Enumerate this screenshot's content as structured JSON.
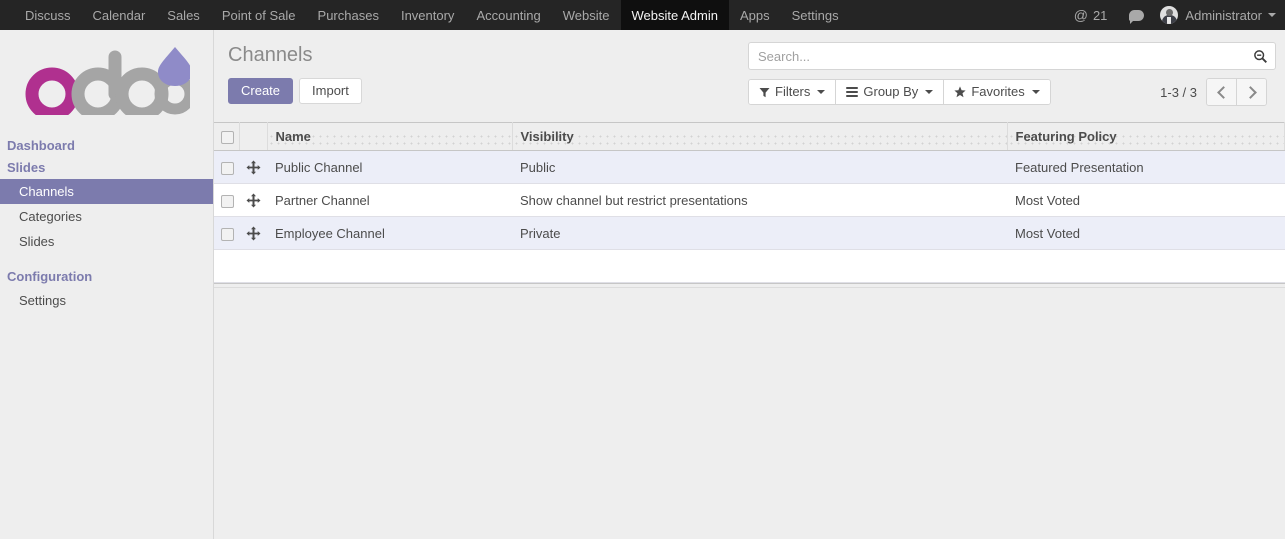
{
  "navbar": {
    "menu_items": [
      {
        "label": "Discuss",
        "active": false
      },
      {
        "label": "Calendar",
        "active": false
      },
      {
        "label": "Sales",
        "active": false
      },
      {
        "label": "Point of Sale",
        "active": false
      },
      {
        "label": "Purchases",
        "active": false
      },
      {
        "label": "Inventory",
        "active": false
      },
      {
        "label": "Accounting",
        "active": false
      },
      {
        "label": "Website",
        "active": false
      },
      {
        "label": "Website Admin",
        "active": true
      },
      {
        "label": "Apps",
        "active": false
      },
      {
        "label": "Settings",
        "active": false
      }
    ],
    "mention_glyph": "@",
    "mention_count": "21",
    "user_name": "Administrator"
  },
  "sidebar": {
    "logo_text": "odoo",
    "sections": [
      {
        "type": "section",
        "label": "Dashboard"
      },
      {
        "type": "section",
        "label": "Slides"
      },
      {
        "type": "link",
        "label": "Channels",
        "active": true
      },
      {
        "type": "link",
        "label": "Categories",
        "active": false
      },
      {
        "type": "link",
        "label": "Slides",
        "active": false
      },
      {
        "type": "gap"
      },
      {
        "type": "section",
        "label": "Configuration"
      },
      {
        "type": "link",
        "label": "Settings",
        "active": false
      }
    ]
  },
  "control_panel": {
    "title": "Channels",
    "create_label": "Create",
    "import_label": "Import",
    "search_placeholder": "Search...",
    "search_value": "",
    "filters_label": "Filters",
    "group_by_label": "Group By",
    "favorites_label": "Favorites",
    "pager_label": "1-3 / 3"
  },
  "list": {
    "columns": [
      {
        "key": "name",
        "label": "Name"
      },
      {
        "key": "visibility",
        "label": "Visibility"
      },
      {
        "key": "featuring_policy",
        "label": "Featuring Policy"
      }
    ],
    "rows": [
      {
        "name": "Public Channel",
        "visibility": "Public",
        "featuring_policy": "Featured Presentation"
      },
      {
        "name": "Partner Channel",
        "visibility": "Show channel but restrict presentations",
        "featuring_policy": "Most Voted"
      },
      {
        "name": "Employee Channel",
        "visibility": "Private",
        "featuring_policy": "Most Voted"
      }
    ]
  }
}
